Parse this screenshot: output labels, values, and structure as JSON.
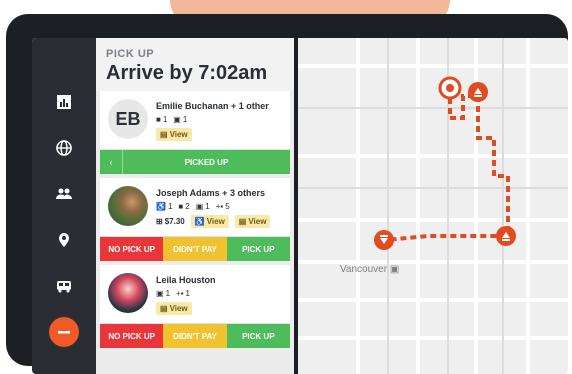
{
  "header": {
    "subtitle": "PICK UP",
    "title": "Arrive by 7:02am"
  },
  "rail": {
    "icons": [
      "chart-icon",
      "globe-icon",
      "people-icon",
      "location-pin-icon",
      "bus-icon",
      "minus-icon"
    ],
    "active": "minus-icon"
  },
  "riders": [
    {
      "initials": "EB",
      "name": "Emilie Buchanan + 1 other",
      "stats": [
        {
          "icon": "seat-icon",
          "value": "1"
        },
        {
          "icon": "bag-icon",
          "value": "1"
        }
      ],
      "view_label": "View",
      "status": "PICKED UP"
    },
    {
      "name": "Joseph Adams + 3 others",
      "stats": [
        {
          "icon": "wheelchair-icon",
          "value": "1"
        },
        {
          "icon": "seat-icon",
          "value": "2"
        },
        {
          "icon": "bag-icon",
          "value": "1"
        },
        {
          "icon": "plus-seat-icon",
          "value": "5"
        }
      ],
      "fare": "$7.30",
      "view_label": "View",
      "view2_label": "View",
      "actions": [
        "NO PICK UP",
        "DIDN'T PAY",
        "PICK UP"
      ]
    },
    {
      "name": "Leila Houston",
      "stats": [
        {
          "icon": "bag-icon",
          "value": "1"
        },
        {
          "icon": "plus-seat-icon",
          "value": "1"
        }
      ],
      "view_label": "View",
      "actions": [
        "NO PICK UP",
        "DIDN'T PAY",
        "PICK UP"
      ]
    }
  ],
  "map": {
    "city_label": "Vancouver",
    "route_color": "#e04b1f"
  }
}
